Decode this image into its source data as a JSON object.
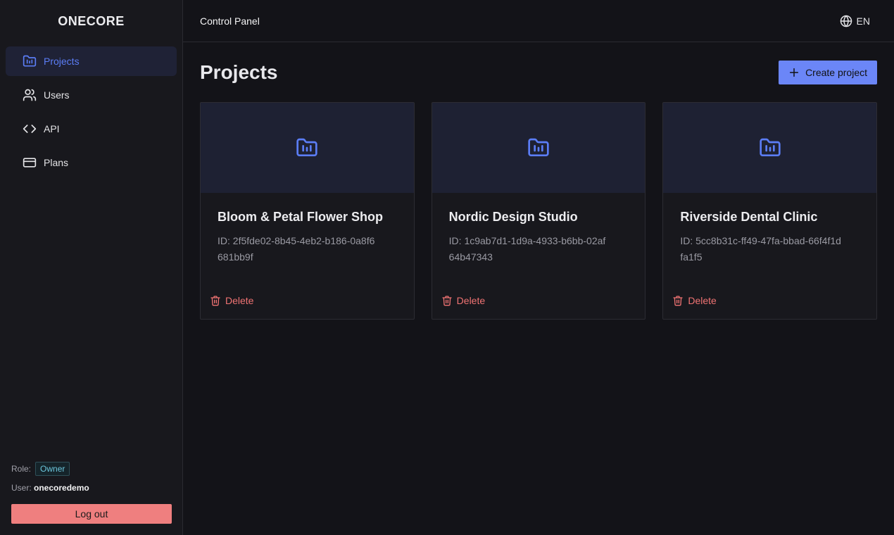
{
  "brand": "ONECORE",
  "sidebar": {
    "items": [
      {
        "label": "Projects",
        "icon": "folder-chart-icon",
        "active": true
      },
      {
        "label": "Users",
        "icon": "users-icon"
      },
      {
        "label": "API",
        "icon": "code-icon"
      },
      {
        "label": "Plans",
        "icon": "credit-card-icon"
      }
    ],
    "role_label": "Role:",
    "role_value": "Owner",
    "user_label": "User:",
    "user_value": "onecoredemo",
    "logout_label": "Log out"
  },
  "header": {
    "title": "Control Panel",
    "language": "EN"
  },
  "main": {
    "title": "Projects",
    "create_label": "Create project",
    "projects": [
      {
        "name": "Bloom & Petal Flower Shop",
        "id": "ID: 2f5fde02-8b45-4eb2-b186-0a8f6681bb9f",
        "delete_label": "Delete"
      },
      {
        "name": "Nordic Design Studio",
        "id": "ID: 1c9ab7d1-1d9a-4933-b6bb-02af64b47343",
        "delete_label": "Delete"
      },
      {
        "name": "Riverside Dental Clinic",
        "id": "ID: 5cc8b31c-ff49-47fa-bbad-66f4f1dfa1f5",
        "delete_label": "Delete"
      }
    ]
  },
  "colors": {
    "accent": "#5b7df6",
    "danger": "#f07373",
    "background": "#131318"
  }
}
